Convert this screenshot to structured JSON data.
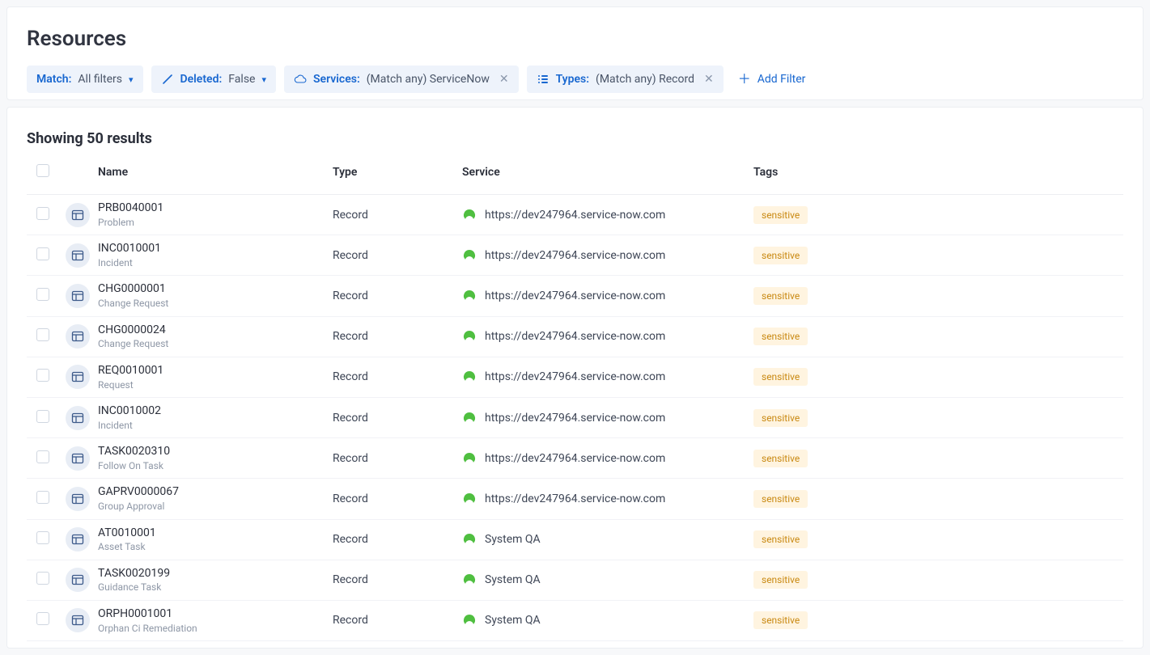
{
  "header": {
    "title": "Resources"
  },
  "filters": {
    "match": {
      "label": "Match",
      "value": "All filters"
    },
    "deleted": {
      "label": "Deleted",
      "value": "False"
    },
    "services": {
      "label": "Services",
      "value": "(Match any) ServiceNow"
    },
    "types": {
      "label": "Types",
      "value": "(Match any) Record"
    },
    "add": "Add Filter"
  },
  "results": {
    "heading": "Showing 50 results",
    "columns": {
      "name": "Name",
      "type": "Type",
      "service": "Service",
      "tags": "Tags"
    },
    "rows": [
      {
        "name": "PRB0040001",
        "subtitle": "Problem",
        "type": "Record",
        "service": "https://dev247964.service-now.com",
        "tag": "sensitive"
      },
      {
        "name": "INC0010001",
        "subtitle": "Incident",
        "type": "Record",
        "service": "https://dev247964.service-now.com",
        "tag": "sensitive"
      },
      {
        "name": "CHG0000001",
        "subtitle": "Change Request",
        "type": "Record",
        "service": "https://dev247964.service-now.com",
        "tag": "sensitive"
      },
      {
        "name": "CHG0000024",
        "subtitle": "Change Request",
        "type": "Record",
        "service": "https://dev247964.service-now.com",
        "tag": "sensitive"
      },
      {
        "name": "REQ0010001",
        "subtitle": "Request",
        "type": "Record",
        "service": "https://dev247964.service-now.com",
        "tag": "sensitive"
      },
      {
        "name": "INC0010002",
        "subtitle": "Incident",
        "type": "Record",
        "service": "https://dev247964.service-now.com",
        "tag": "sensitive"
      },
      {
        "name": "TASK0020310",
        "subtitle": "Follow On Task",
        "type": "Record",
        "service": "https://dev247964.service-now.com",
        "tag": "sensitive"
      },
      {
        "name": "GAPRV0000067",
        "subtitle": "Group Approval",
        "type": "Record",
        "service": "https://dev247964.service-now.com",
        "tag": "sensitive"
      },
      {
        "name": "AT0010001",
        "subtitle": "Asset Task",
        "type": "Record",
        "service": "System QA",
        "tag": "sensitive"
      },
      {
        "name": "TASK0020199",
        "subtitle": "Guidance Task",
        "type": "Record",
        "service": "System QA",
        "tag": "sensitive"
      },
      {
        "name": "ORPH0001001",
        "subtitle": "Orphan Ci Remediation",
        "type": "Record",
        "service": "System QA",
        "tag": "sensitive"
      }
    ]
  }
}
